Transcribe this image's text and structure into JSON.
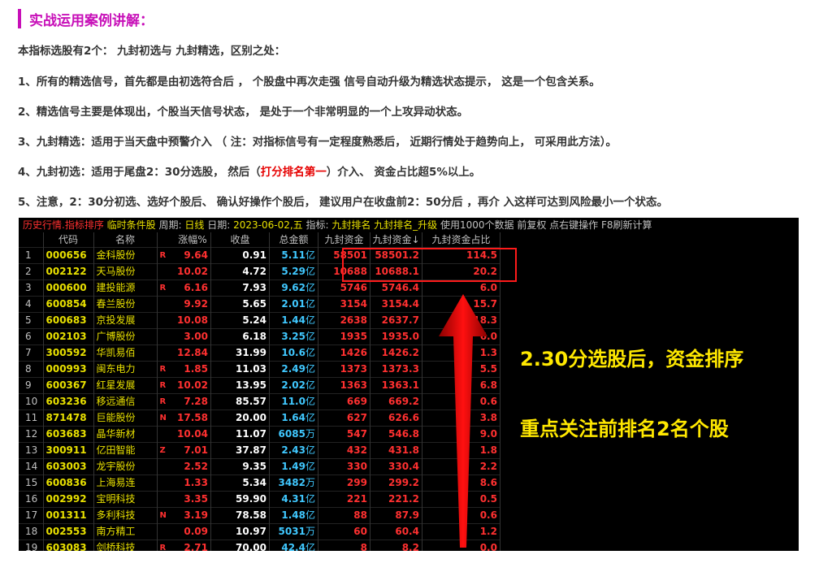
{
  "heading": "实战运用案例讲解：",
  "paragraphs": [
    "本指标选股有2个： 九封初选与 九封精选，区别之处：",
    "1、所有的精选信号，首先都是由初选符合后 ， 个股盘中再次走强 信号自动升级为精选状态提示， 这是一个包含关系。",
    "2、精选信号主要是体现出，个股当天信号状态， 是处于一个非常明显的一个上攻异动状态。",
    "3、九封精选：适用于当天盘中预警介入 （ 注：对指标信号有一定程度熟悉后， 近期行情处于趋势向上， 可采用此方法）。"
  ],
  "para4": {
    "before": "4、九封初选：适用于尾盘2：30分选股， 然后（",
    "highlight": "打分排名第一",
    "after": "）介入、  资金占比超5%以上。"
  },
  "para5": "5、注意，2：30分初选、选好个股后、 确认好操作个股后， 建议用户在收盘前2：50分后 ，再介 入这样可达到风险最小一个状态。",
  "toolbar": {
    "mode": "历史行情.指标排序",
    "condition": "临时条件股",
    "period_label": "周期:",
    "period_value": "日线",
    "date_label": "日期:",
    "date_value": "2023-06-02,五",
    "indicator_label": "指标:",
    "indicator_value": "九封排名 九封排名_升级",
    "note": "使用1000个数据 前复权 点右键操作 F8刷新计算"
  },
  "columns": [
    "代码",
    "名称",
    "涨幅%",
    "收盘",
    "总金额",
    "九封资金",
    "九封资金↓",
    "九封资金占比"
  ],
  "rows": [
    {
      "idx": "1",
      "code": "000656",
      "name": "金科股份",
      "flag": "R",
      "pct": "9.64",
      "close": "0.91",
      "amt": "5.11",
      "unit": "亿",
      "f1": "58501",
      "f2": "58501.2",
      "ratio": "114.5"
    },
    {
      "idx": "2",
      "code": "002122",
      "name": "天马股份",
      "flag": "",
      "pct": "10.02",
      "close": "4.72",
      "amt": "5.29",
      "unit": "亿",
      "f1": "10688",
      "f2": "10688.1",
      "ratio": "20.2"
    },
    {
      "idx": "3",
      "code": "000600",
      "name": "建投能源",
      "flag": "R",
      "pct": "6.16",
      "close": "7.93",
      "amt": "9.62",
      "unit": "亿",
      "f1": "5746",
      "f2": "5746.4",
      "ratio": "6.0"
    },
    {
      "idx": "4",
      "code": "600854",
      "name": "春兰股份",
      "flag": "",
      "pct": "9.92",
      "close": "5.65",
      "amt": "2.01",
      "unit": "亿",
      "f1": "3154",
      "f2": "3154.4",
      "ratio": "15.7"
    },
    {
      "idx": "5",
      "code": "600683",
      "name": "京投发展",
      "flag": "",
      "pct": "10.08",
      "close": "5.24",
      "amt": "1.44",
      "unit": "亿",
      "f1": "2638",
      "f2": "2637.7",
      "ratio": "18.3"
    },
    {
      "idx": "6",
      "code": "002103",
      "name": "广博股份",
      "flag": "",
      "pct": "3.00",
      "close": "6.18",
      "amt": "3.25",
      "unit": "亿",
      "f1": "1935",
      "f2": "1935.0",
      "ratio": "6.0"
    },
    {
      "idx": "7",
      "code": "300592",
      "name": "华凯易佰",
      "flag": "",
      "pct": "12.84",
      "close": "31.99",
      "amt": "10.6",
      "unit": "亿",
      "f1": "1426",
      "f2": "1426.2",
      "ratio": "1.3"
    },
    {
      "idx": "8",
      "code": "000993",
      "name": "闽东电力",
      "flag": "R",
      "pct": "1.85",
      "close": "11.03",
      "amt": "2.49",
      "unit": "亿",
      "f1": "1373",
      "f2": "1373.3",
      "ratio": "5.5"
    },
    {
      "idx": "9",
      "code": "600367",
      "name": "红星发展",
      "flag": "R",
      "pct": "10.02",
      "close": "13.95",
      "amt": "2.02",
      "unit": "亿",
      "f1": "1363",
      "f2": "1363.1",
      "ratio": "6.8"
    },
    {
      "idx": "10",
      "code": "603236",
      "name": "移远通信",
      "flag": "R",
      "pct": "7.28",
      "close": "85.57",
      "amt": "11.0",
      "unit": "亿",
      "f1": "669",
      "f2": "669.2",
      "ratio": "0.6"
    },
    {
      "idx": "11",
      "code": "871478",
      "name": "巨能股份",
      "flag": "N",
      "pct": "17.58",
      "close": "20.00",
      "amt": "1.64",
      "unit": "亿",
      "f1": "627",
      "f2": "626.6",
      "ratio": "3.8"
    },
    {
      "idx": "12",
      "code": "603683",
      "name": "晶华新材",
      "flag": "",
      "pct": "10.04",
      "close": "11.07",
      "amt": "6085",
      "unit": "万",
      "f1": "547",
      "f2": "546.8",
      "ratio": "9.0"
    },
    {
      "idx": "13",
      "code": "300911",
      "name": "亿田智能",
      "flag": "Z",
      "pct": "7.01",
      "close": "37.87",
      "amt": "2.43",
      "unit": "亿",
      "f1": "432",
      "f2": "431.8",
      "ratio": "1.8"
    },
    {
      "idx": "14",
      "code": "603003",
      "name": "龙宇股份",
      "flag": "",
      "pct": "2.52",
      "close": "9.35",
      "amt": "1.49",
      "unit": "亿",
      "f1": "330",
      "f2": "330.4",
      "ratio": "2.2"
    },
    {
      "idx": "15",
      "code": "600836",
      "name": "上海易连",
      "flag": "",
      "pct": "1.33",
      "close": "5.34",
      "amt": "3482",
      "unit": "万",
      "f1": "299",
      "f2": "299.2",
      "ratio": "8.6"
    },
    {
      "idx": "16",
      "code": "002992",
      "name": "宝明科技",
      "flag": "",
      "pct": "3.35",
      "close": "59.90",
      "amt": "4.31",
      "unit": "亿",
      "f1": "221",
      "f2": "221.2",
      "ratio": "0.5"
    },
    {
      "idx": "17",
      "code": "001311",
      "name": "多利科技",
      "flag": "N",
      "pct": "3.19",
      "close": "78.58",
      "amt": "1.48",
      "unit": "亿",
      "f1": "88",
      "f2": "87.9",
      "ratio": "0.6"
    },
    {
      "idx": "18",
      "code": "002553",
      "name": "南方精工",
      "flag": "",
      "pct": "0.09",
      "close": "10.97",
      "amt": "5031",
      "unit": "万",
      "f1": "60",
      "f2": "60.4",
      "ratio": "1.2"
    },
    {
      "idx": "19",
      "code": "603083",
      "name": "剑桥科技",
      "flag": "R",
      "pct": "2.71",
      "close": "70.00",
      "amt": "42.4",
      "unit": "亿",
      "f1": "8",
      "f2": "8.2",
      "ratio": "0.0"
    }
  ],
  "annotations": {
    "line1": "2.30分选股后，资金排序",
    "line2": "重点关注前排名2名个股"
  },
  "colors": {
    "heading": "#c70fb8",
    "up": "#ff3030",
    "stock_code": "#e8e000",
    "amount": "#40c8ff",
    "annotation": "#ffe800",
    "highlight_box": "#ff1a1a"
  }
}
